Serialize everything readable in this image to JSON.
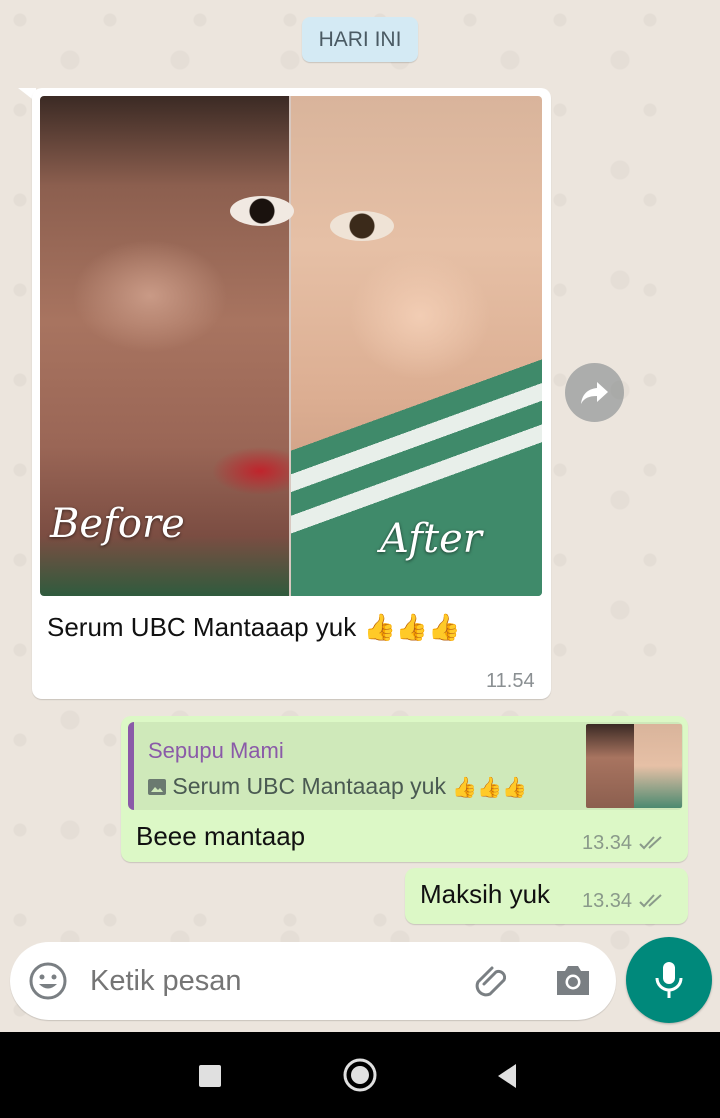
{
  "date_chip": "HARI INI",
  "incoming": {
    "photo_labels": {
      "before": "Before",
      "after": "After"
    },
    "caption": "Serum UBC Mantaaap yuk",
    "caption_emoji": "👍👍👍",
    "time": "11.54"
  },
  "reply": {
    "quote_name": "Sepupu Mami",
    "quote_text": "Serum UBC Mantaaap yuk",
    "quote_emoji": "👍👍👍",
    "text": "Beee mantaap",
    "time": "13.34"
  },
  "second_reply": {
    "text": "Maksih yuk",
    "time": "13.34"
  },
  "input": {
    "placeholder": "Ketik pesan"
  },
  "icons": {
    "forward": "forward-icon",
    "emoji": "emoji-icon",
    "attach": "paperclip-icon",
    "camera": "camera-icon",
    "mic": "mic-icon",
    "nav_recents": "square-icon",
    "nav_home": "circle-icon",
    "nav_back": "triangle-back-icon"
  },
  "colors": {
    "accent": "#00897b",
    "outgoing_bubble": "#dcf8c6",
    "quote_name": "#8a5aa8",
    "read_ticks": "#8a9a8a"
  }
}
